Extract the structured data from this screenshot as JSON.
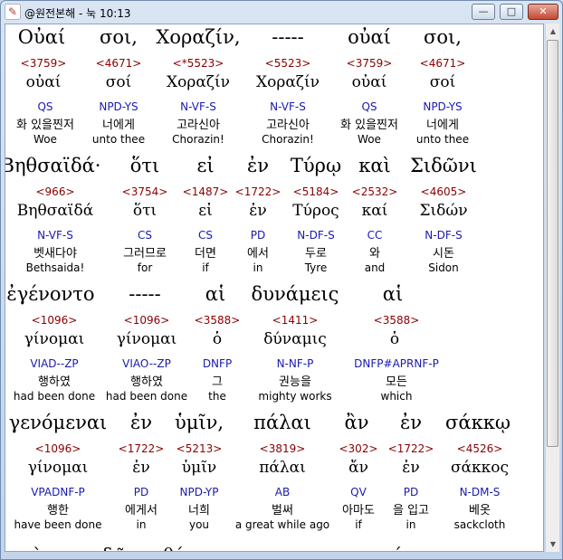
{
  "window": {
    "title": "@원전본해 - 눅 10:13",
    "app_icon": "app-logo-icon",
    "buttons": {
      "minimize": "—",
      "maximize": "□",
      "close": "✕"
    }
  },
  "rows": [
    {
      "words": [
        {
          "greek": "Οὐαί",
          "strong": "<3759>",
          "lemma": "οὐαί",
          "parse": "QS",
          "korean": "화 있을찐저",
          "english": "Woe"
        },
        {
          "greek": "σοι,",
          "strong": "<4671>",
          "lemma": "σοί",
          "parse": "NPD-YS",
          "korean": "너에게",
          "english": "unto thee"
        },
        {
          "greek": "Χοραζίν,",
          "strong": "<*5523>",
          "lemma": "Χοραζίν",
          "parse": "N-VF-S",
          "korean": "고라신아",
          "english": "Chorazin!"
        },
        {
          "greek": "-----",
          "strong": "<5523>",
          "lemma": "Χοραζίν",
          "parse": "N-VF-S",
          "korean": "고라신아",
          "english": "Chorazin!"
        },
        {
          "greek": "οὐαί",
          "strong": "<3759>",
          "lemma": "οὐαί",
          "parse": "QS",
          "korean": "화 있을찐저",
          "english": "Woe"
        },
        {
          "greek": "σοι,",
          "strong": "<4671>",
          "lemma": "σοί",
          "parse": "NPD-YS",
          "korean": "너에게",
          "english": "unto thee"
        }
      ]
    },
    {
      "words": [
        {
          "greek": "Βηθσαϊδά·",
          "strong": "<966>",
          "lemma": "Βηθσαϊδά",
          "parse": "N-VF-S",
          "korean": "벳새다야",
          "english": "Bethsaida!"
        },
        {
          "greek": "ὅτι",
          "strong": "<3754>",
          "lemma": "ὅτι",
          "parse": "CS",
          "korean": "그러므로",
          "english": "for"
        },
        {
          "greek": "εἰ",
          "strong": "<1487>",
          "lemma": "εἰ",
          "parse": "CS",
          "korean": "더면",
          "english": "if"
        },
        {
          "greek": "ἐν",
          "strong": "<1722>",
          "lemma": "ἐν",
          "parse": "PD",
          "korean": "에서",
          "english": "in"
        },
        {
          "greek": "Τύρῳ",
          "strong": "<5184>",
          "lemma": "Τύρος",
          "parse": "N-DF-S",
          "korean": "두로",
          "english": "Tyre"
        },
        {
          "greek": "καὶ",
          "strong": "<2532>",
          "lemma": "καί",
          "parse": "CC",
          "korean": "와",
          "english": "and"
        },
        {
          "greek": "Σιδῶνι",
          "strong": "<4605>",
          "lemma": "Σιδών",
          "parse": "N-DF-S",
          "korean": "시돈",
          "english": "Sidon"
        }
      ]
    },
    {
      "words": [
        {
          "greek": "ἐγένοντο",
          "strong": "<1096>",
          "lemma": "γίνομαι",
          "parse": "VIAD--ZP",
          "korean": "행하였",
          "english": "had been done"
        },
        {
          "greek": "-----",
          "strong": "<1096>",
          "lemma": "γίνομαι",
          "parse": "VIAO--ZP",
          "korean": "행하였",
          "english": "had been done"
        },
        {
          "greek": "αἱ",
          "strong": "<3588>",
          "lemma": "ὁ",
          "parse": "DNFP",
          "korean": "그",
          "english": "the"
        },
        {
          "greek": "δυνάμεις",
          "strong": "<1411>",
          "lemma": "δύναμις",
          "parse": "N-NF-P",
          "korean": "권능을",
          "english": "mighty works"
        },
        {
          "greek": "αἱ",
          "strong": "<3588>",
          "lemma": "ὁ",
          "parse": "DNFP#APRNF-P",
          "korean": "모든",
          "english": "which"
        }
      ]
    },
    {
      "words": [
        {
          "greek": "γενόμεναι",
          "strong": "<1096>",
          "lemma": "γίνομαι",
          "parse": "VPADNF-P",
          "korean": "행한",
          "english": "have been done"
        },
        {
          "greek": "ἐν",
          "strong": "<1722>",
          "lemma": "ἐν",
          "parse": "PD",
          "korean": "에게서",
          "english": "in"
        },
        {
          "greek": "ὑμῖν,",
          "strong": "<5213>",
          "lemma": "ὑμῖν",
          "parse": "NPD-YP",
          "korean": "너희",
          "english": "you"
        },
        {
          "greek": "πάλαι",
          "strong": "<3819>",
          "lemma": "πάλαι",
          "parse": "AB",
          "korean": "벌써",
          "english": "a great while ago"
        },
        {
          "greek": "ἂν",
          "strong": "<302>",
          "lemma": "ἄν",
          "parse": "QV",
          "korean": "아마도",
          "english": "if"
        },
        {
          "greek": "ἐν",
          "strong": "<1722>",
          "lemma": "ἐν",
          "parse": "PD",
          "korean": "을 입고",
          "english": "in"
        },
        {
          "greek": "σάκκῳ",
          "strong": "<4526>",
          "lemma": "σάκκος",
          "parse": "N-DM-S",
          "korean": "베옷",
          "english": "sackcloth"
        }
      ]
    }
  ],
  "partial_row": [
    "καὶ",
    "σποδῷ",
    "καθήμεναι",
    "μετενόησαν"
  ]
}
